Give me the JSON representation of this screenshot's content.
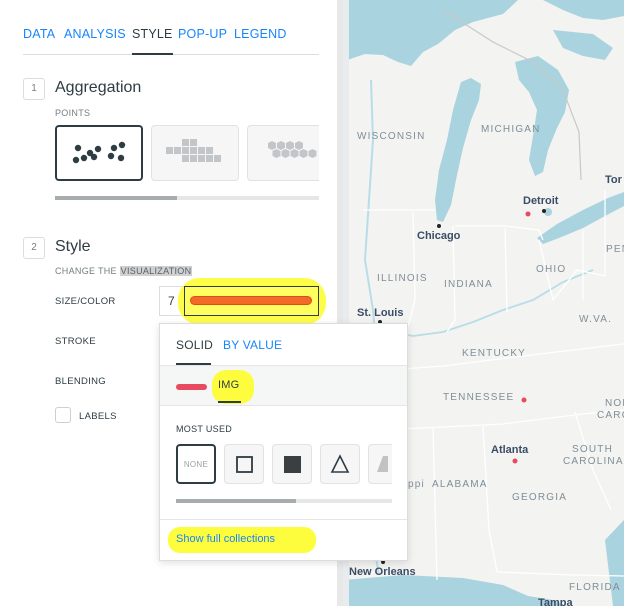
{
  "tabs": [
    {
      "label": "DATA",
      "active": false
    },
    {
      "label": "ANALYSIS",
      "active": false
    },
    {
      "label": "STYLE",
      "active": true
    },
    {
      "label": "POP-UP",
      "active": false
    },
    {
      "label": "LEGEND",
      "active": false
    }
  ],
  "aggregation": {
    "step": "1",
    "title": "Aggregation",
    "caption": "POINTS",
    "options": [
      "points",
      "squares",
      "hexagons"
    ],
    "selected": "points"
  },
  "style_section": {
    "step": "2",
    "title": "Style",
    "caption_prefix": "CHANGE THE ",
    "caption_highlight": "VISUALIZATION",
    "size_color_label": "SIZE/COLOR",
    "size_value": "7",
    "color_value": "#f16a28",
    "stroke_label": "STROKE",
    "blending_label": "BLENDING",
    "labels_label": "LABELS"
  },
  "popover": {
    "tabs": [
      {
        "label": "SOLID",
        "active": true
      },
      {
        "label": "BY VALUE",
        "active": false
      }
    ],
    "fill_color": "#e84a5f",
    "img_tab": "IMG",
    "most_used_label": "MOST USED",
    "none_label": "NONE",
    "markers": [
      "none",
      "square-outline-icon",
      "square-filled-icon",
      "triangle-outline-icon",
      "triangle-partial-icon"
    ],
    "show_full_link": "Show full collections"
  },
  "map": {
    "states": [
      "WISCONSIN",
      "MICHIGAN",
      "ILLINOIS",
      "INDIANA",
      "OHIO",
      "W.VA.",
      "KENTUCKY",
      "TENNESSEE",
      "ALABAMA",
      "GEORGIA",
      "FLORIDA",
      "SOUTH",
      "CAROLINA",
      "NORT",
      "CARO",
      "PEN",
      "ppi"
    ],
    "cities": [
      "Detroit",
      "Chicago",
      "St. Louis",
      "Atlanta",
      "New Orleans",
      "Tampa",
      "Tor"
    ]
  },
  "colors": {
    "accent": "#1785fb",
    "text": "#2e3c43",
    "water": "#a9d3de",
    "highlight": "#fdfd3e"
  }
}
